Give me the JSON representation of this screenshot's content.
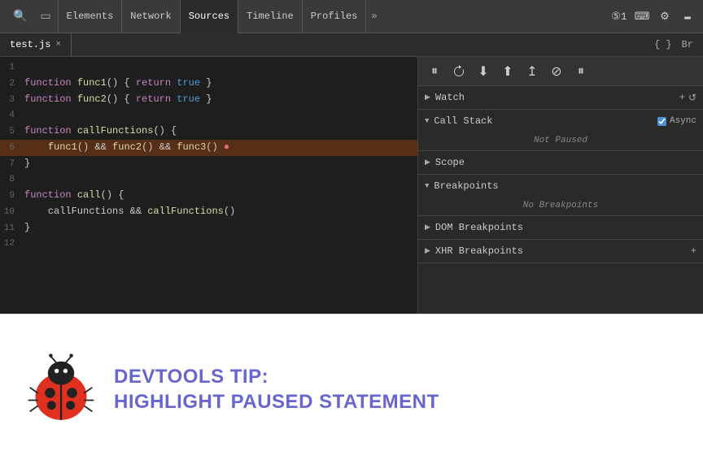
{
  "nav": {
    "tabs": [
      {
        "label": "Elements",
        "active": false
      },
      {
        "label": "Network",
        "active": false
      },
      {
        "label": "Sources",
        "active": true
      },
      {
        "label": "Timeline",
        "active": false
      },
      {
        "label": "Profiles",
        "active": false
      }
    ],
    "more": "»",
    "counter": "⑤1",
    "icons": {
      "search": "🔍",
      "mobile": "📱",
      "terminal": ">_",
      "settings": "⚙",
      "monitor": "🖥"
    }
  },
  "toolbar": {
    "play_label": "▶",
    "file_tab": "test.js",
    "close": "×",
    "tab_btns": [
      "◀◀",
      "Br"
    ]
  },
  "debugbar": {
    "pause": "⏸",
    "reload": "↺",
    "stepover": "↓",
    "stepinto": "↑",
    "stepout": "⤴",
    "deactivate": "⊘",
    "pause_right": "⏸"
  },
  "panels": {
    "watch": {
      "label": "Watch",
      "add": "+",
      "refresh": "↺",
      "collapsed": false
    },
    "callstack": {
      "label": "Call Stack",
      "async_label": "Async",
      "collapsed": false,
      "status": "Not Paused"
    },
    "scope": {
      "label": "Scope",
      "collapsed": true
    },
    "breakpoints": {
      "label": "Breakpoints",
      "collapsed": false,
      "status": "No Breakpoints"
    },
    "dom_breakpoints": {
      "label": "DOM Breakpoints",
      "collapsed": true
    },
    "xhr_breakpoints": {
      "label": "XHR Breakpoints",
      "collapsed": true
    }
  },
  "code": {
    "lines": [
      {
        "num": "1",
        "code": ""
      },
      {
        "num": "2",
        "code": "function func1() { return true }"
      },
      {
        "num": "3",
        "code": "function func2() { return true }"
      },
      {
        "num": "4",
        "code": ""
      },
      {
        "num": "5",
        "code": "function callFunctions() {"
      },
      {
        "num": "6",
        "code": "    func1() && func2() && func3() ●",
        "highlight": true
      },
      {
        "num": "7",
        "code": "}"
      },
      {
        "num": "8",
        "code": ""
      },
      {
        "num": "9",
        "code": "function call() {"
      },
      {
        "num": "10",
        "code": "    callFunctions && callFunctions()"
      },
      {
        "num": "11",
        "code": "}"
      },
      {
        "num": "12",
        "code": ""
      }
    ]
  },
  "tip": {
    "title_line1": "DevTools Tip:",
    "title_line2": "Highlight Paused Statement"
  }
}
